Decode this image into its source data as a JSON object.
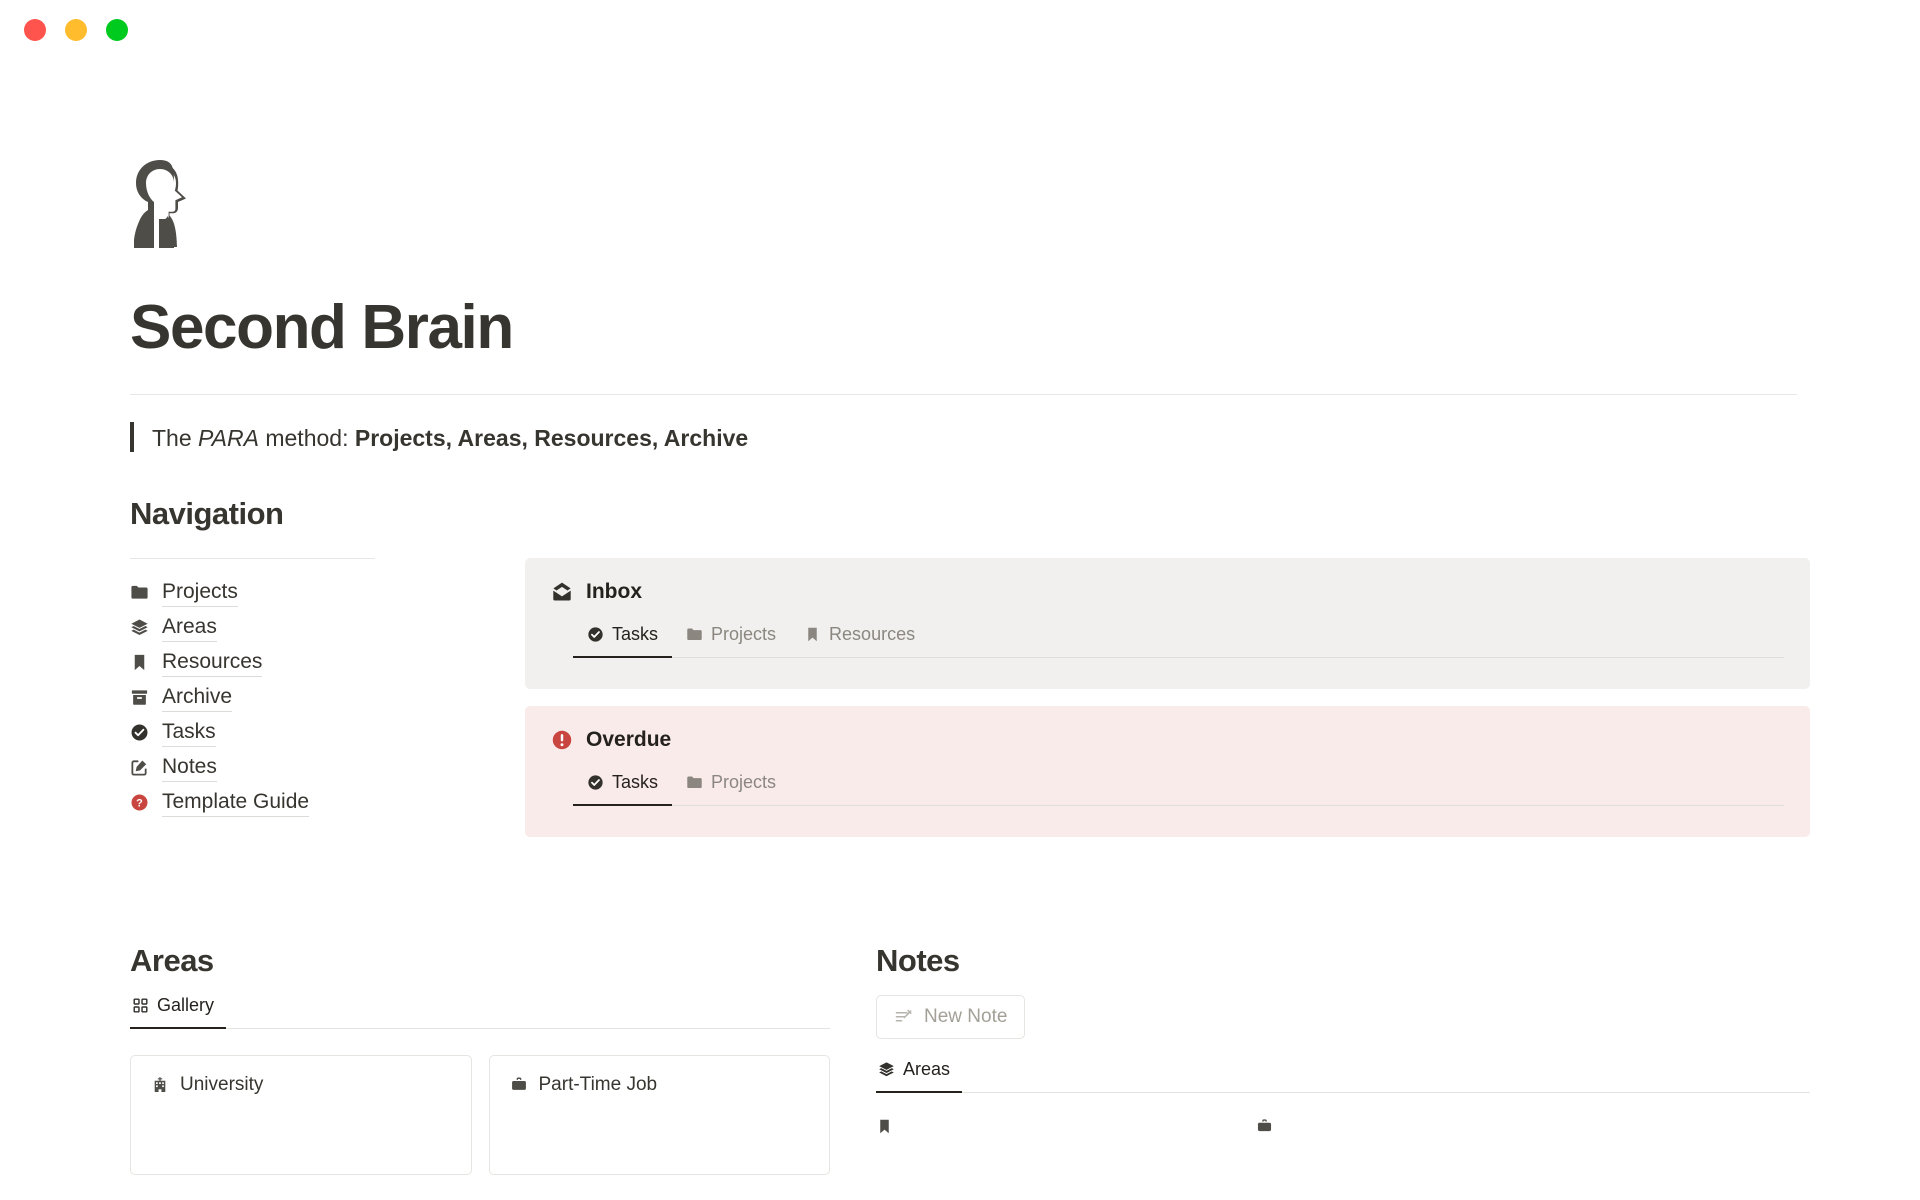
{
  "window": {
    "traffic_lights": [
      {
        "name": "close",
        "color": "#FF544D"
      },
      {
        "name": "minimize",
        "color": "#FFBD2E"
      },
      {
        "name": "maximize",
        "color": "#00CA1E"
      }
    ]
  },
  "hero": {
    "page_icon": "head-profile-icon",
    "title": "Second Brain"
  },
  "quote": {
    "prefix": "The ",
    "italic": "PARA",
    "middle": " method: ",
    "bold": "Projects, Areas, Resources, Archive"
  },
  "navigation": {
    "heading": "Navigation",
    "items": [
      {
        "label": "Projects",
        "icon": "folder-icon"
      },
      {
        "label": "Areas",
        "icon": "layers-icon"
      },
      {
        "label": "Resources",
        "icon": "bookmark-icon"
      },
      {
        "label": "Archive",
        "icon": "archive-box-icon"
      },
      {
        "label": "Tasks",
        "icon": "check-circle-icon"
      },
      {
        "label": "Notes",
        "icon": "pencil-square-icon"
      },
      {
        "label": "Template Guide",
        "icon": "question-circle-icon"
      }
    ]
  },
  "panels": [
    {
      "key": "inbox",
      "title": "Inbox",
      "icon": "open-envelope-icon",
      "background": "#F1F0EE",
      "tabs": [
        {
          "label": "Tasks",
          "icon": "check-circle-icon",
          "active": true
        },
        {
          "label": "Projects",
          "icon": "folder-icon",
          "active": false
        },
        {
          "label": "Resources",
          "icon": "bookmark-icon",
          "active": false
        }
      ]
    },
    {
      "key": "overdue",
      "title": "Overdue",
      "icon": "alert-circle-icon",
      "background": "#FAEBEB",
      "accent": "#C9453F",
      "tabs": [
        {
          "label": "Tasks",
          "icon": "check-circle-icon",
          "active": true
        },
        {
          "label": "Projects",
          "icon": "folder-icon",
          "active": false
        }
      ]
    }
  ],
  "areas": {
    "heading": "Areas",
    "tabs": [
      {
        "label": "Gallery",
        "icon": "grid-icon",
        "active": true
      }
    ],
    "cards": [
      {
        "title": "University",
        "icon": "school-icon"
      },
      {
        "title": "Part-Time Job",
        "icon": "briefcase-icon"
      }
    ]
  },
  "notes": {
    "heading": "Notes",
    "new_note_label": "New Note",
    "new_note_icon": "note-edit-icon",
    "tabs": [
      {
        "label": "Areas",
        "icon": "layers-icon",
        "active": true
      }
    ]
  },
  "colors": {
    "text": "#37352f",
    "muted": "#8b8780",
    "rule": "#e8e7e4",
    "red": "#C9453F"
  }
}
